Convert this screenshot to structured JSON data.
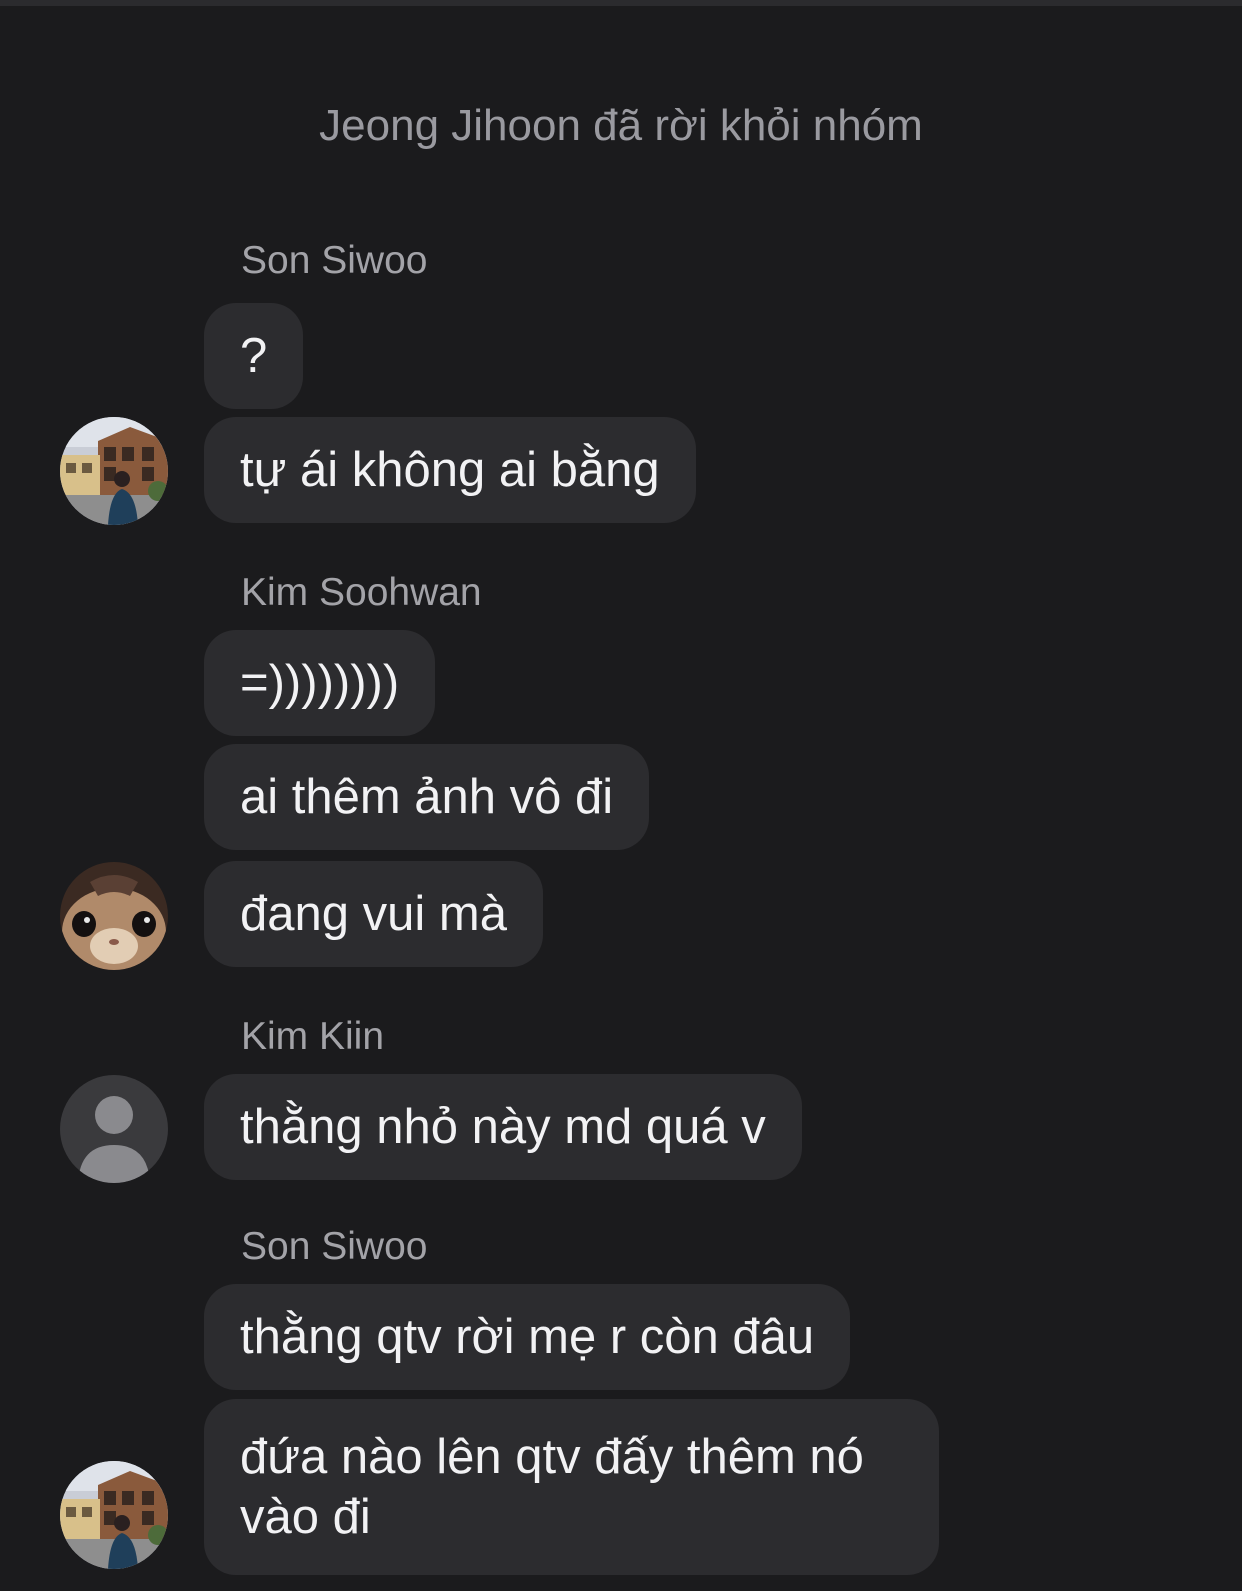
{
  "system_notice": "Jeong Jihoon đã rời khỏi nhóm",
  "groups": [
    {
      "sender": "Son Siwoo",
      "avatar": "person-photo-avatar",
      "messages": [
        "?",
        "tự ái không ai bằng"
      ]
    },
    {
      "sender": "Kim Soohwan",
      "avatar": "cat-photo-avatar",
      "messages": [
        "=))))))))",
        "ai thêm ảnh vô đi",
        "đang vui mà"
      ]
    },
    {
      "sender": "Kim Kiin",
      "avatar": "default-person-avatar",
      "messages": [
        "thằng nhỏ này md quá v"
      ]
    },
    {
      "sender": "Son Siwoo",
      "avatar": "person-photo-avatar",
      "messages": [
        "thằng qtv rời mẹ r còn đâu",
        "đứa nào lên qtv đấy thêm nó vào đi"
      ]
    }
  ],
  "colors": {
    "background": "#1b1b1d",
    "bubble": "#2c2c2f",
    "message_text": "#f2f2f4",
    "secondary_text": "#a3a3a8"
  }
}
